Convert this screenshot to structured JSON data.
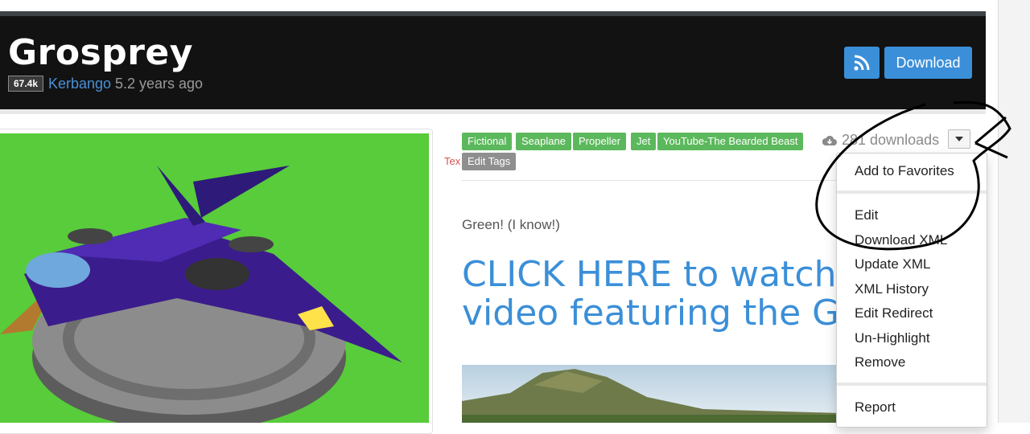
{
  "header": {
    "title": "Grosprey",
    "views": "67.4k",
    "author": "Kerbango",
    "age": "5.2 years ago",
    "download_label": "Download",
    "rss_icon": "rss-icon"
  },
  "tags": {
    "items": [
      "Fictional",
      "Seaplane",
      "Propeller",
      "Jet",
      "YouTube-The Bearded Beast"
    ],
    "edit_label": "Edit Tags",
    "overlapped_text": "Tex"
  },
  "stats": {
    "downloads": "281 downloads",
    "downloads_icon": "cloud-download-icon"
  },
  "content": {
    "description": "Green! (I know!)",
    "link_line1": "CLICK HERE to watch Fran",
    "link_line2": "video featuring the Grospr"
  },
  "menu": {
    "items": [
      "Add to Favorites",
      "Edit",
      "Download XML",
      "Update XML",
      "XML History",
      "Edit Redirect",
      "Un-Highlight",
      "Remove",
      "Report"
    ]
  },
  "colors": {
    "header_bg": "#121212",
    "accent_blue": "#3b8fd8",
    "tag_green": "#5cb85c",
    "image_green": "#58cc3a"
  }
}
